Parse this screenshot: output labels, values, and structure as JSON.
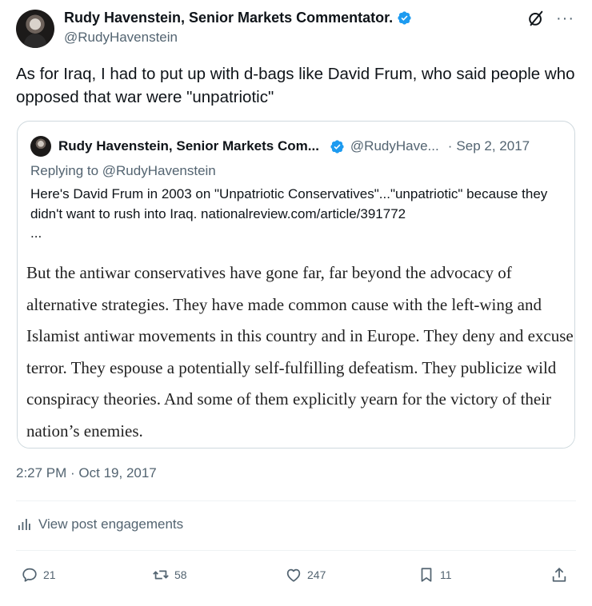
{
  "author": {
    "display_name": "Rudy Havenstein, Senior Markets Commentator.",
    "handle": "@RudyHavenstein"
  },
  "icons": {
    "verified": "verified-badge-icon",
    "grok": "grok-icon",
    "more": "more-icon",
    "engagements": "analytics-icon",
    "reply": "reply-icon",
    "repost": "repost-icon",
    "like": "like-icon",
    "bookmark": "bookmark-icon",
    "share": "share-icon"
  },
  "colors": {
    "verified": "#1d9bf0",
    "secondary_text": "#536471",
    "border": "#cfd9de"
  },
  "tweet": {
    "text": "As for Iraq, I had to put up with d-bags like David Frum, who said people who opposed that war were \"unpatriotic\"",
    "timestamp": "2:27 PM · Oct 19, 2017",
    "view_engagements": "View post engagements"
  },
  "quote": {
    "display_name": "Rudy Havenstein, Senior Markets Com...",
    "handle": "@RudyHave...",
    "dot": "·",
    "date": "Sep 2, 2017",
    "replying_to": "Replying to @RudyHavenstein",
    "text": "Here's David Frum in 2003 on \"Unpatriotic Conservatives\"...\"unpatriotic\" because they didn't want to rush into Iraq. nationalreview.com/article/391772",
    "ellipsis": "...",
    "image_excerpt": "But the antiwar conservatives have gone far, far beyond the advocacy of alternative strategies. They have made common cause with the left-wing and Islamist antiwar movements in this country and in Europe. They deny and excuse terror. They espouse a potentially self-fulfilling defeatism. They publicize wild conspiracy theories. And some of them explicitly yearn for the victory of their nation’s enemies."
  },
  "actions": {
    "replies": "21",
    "reposts": "58",
    "likes": "247",
    "bookmarks": "11"
  }
}
